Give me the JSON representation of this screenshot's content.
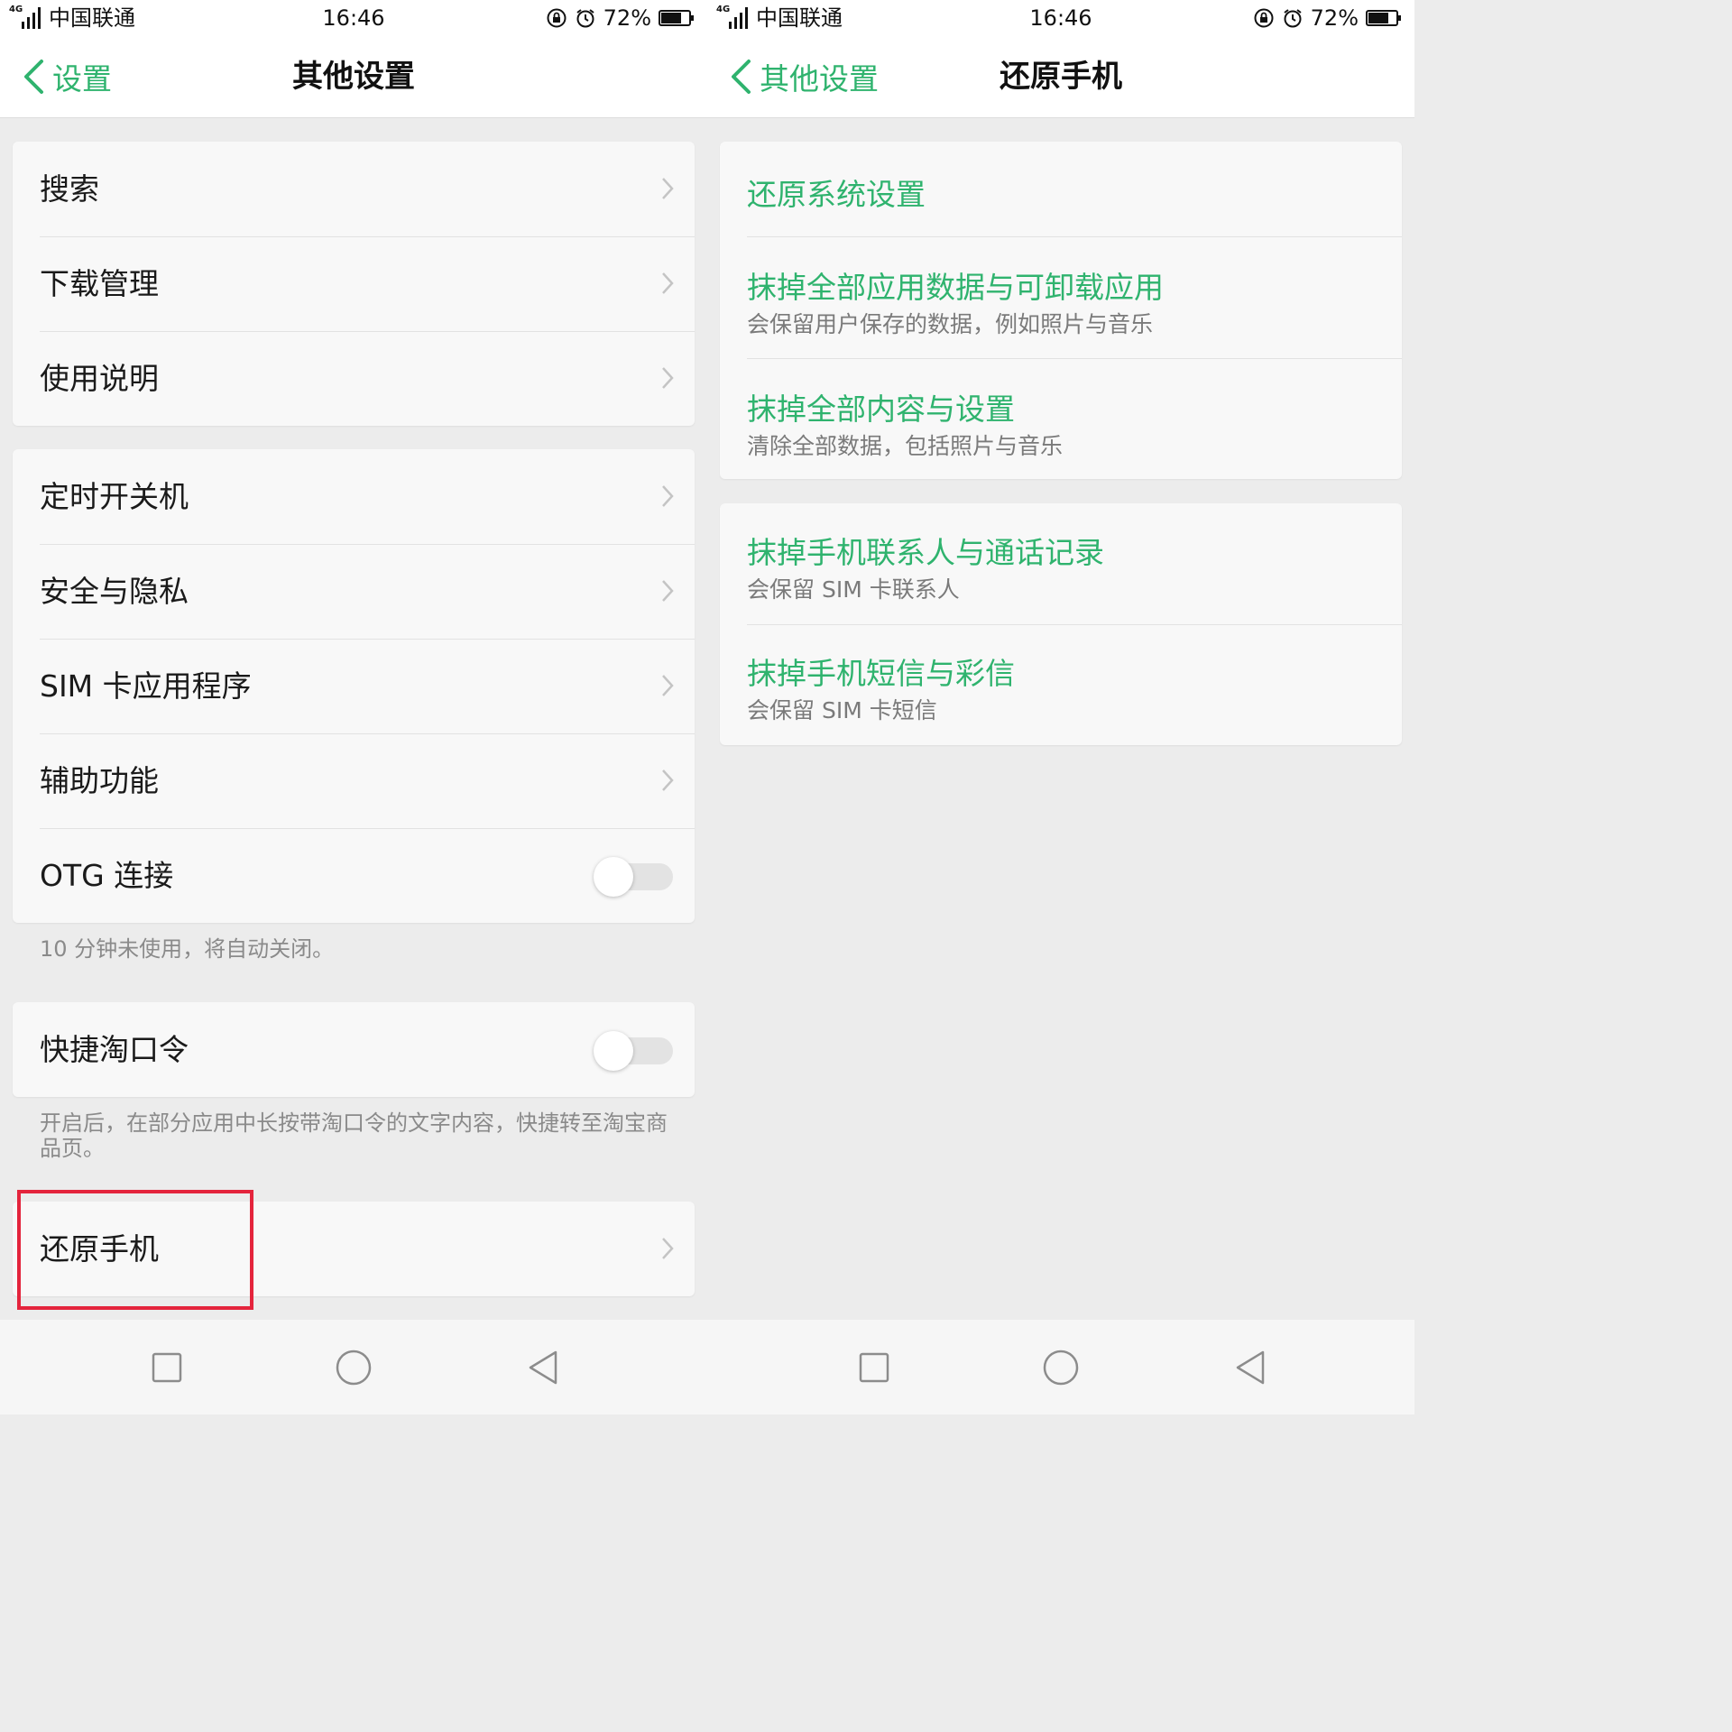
{
  "colors": {
    "accent": "#2fb36e",
    "highlight": "#e4243c"
  },
  "left": {
    "status": {
      "network": "4G",
      "carrier": "中国联通",
      "time": "16:46",
      "battery": "72%",
      "icons": [
        "rotation-lock-icon",
        "alarm-icon",
        "battery-icon"
      ]
    },
    "nav": {
      "back_label": "设置",
      "title": "其他设置"
    },
    "group1": [
      "搜索",
      "下载管理",
      "使用说明"
    ],
    "group2": [
      "定时开关机",
      "安全与隐私",
      "SIM 卡应用程序",
      "辅助功能"
    ],
    "otg": {
      "label": "OTG 连接",
      "on": false,
      "note": "10 分钟未使用，将自动关闭。"
    },
    "taobao": {
      "label": "快捷淘口令",
      "on": false,
      "note": "开启后，在部分应用中长按带淘口令的文字内容，快捷转至淘宝商品页。"
    },
    "reset": {
      "label": "还原手机"
    },
    "sysnav": [
      "square-recents-icon",
      "circle-home-icon",
      "triangle-back-icon"
    ]
  },
  "right": {
    "status": {
      "network": "4G",
      "carrier": "中国联通",
      "time": "16:46",
      "battery": "72%"
    },
    "nav": {
      "back_label": "其他设置",
      "title": "还原手机"
    },
    "group1": [
      {
        "title": "还原系统设置",
        "subtitle": ""
      },
      {
        "title": "抹掉全部应用数据与可卸载应用",
        "subtitle": "会保留用户保存的数据，例如照片与音乐"
      },
      {
        "title": "抹掉全部内容与设置",
        "subtitle": "清除全部数据，包括照片与音乐"
      }
    ],
    "group2": [
      {
        "title": "抹掉手机联系人与通话记录",
        "subtitle": "会保留 SIM 卡联系人"
      },
      {
        "title": "抹掉手机短信与彩信",
        "subtitle": "会保留 SIM 卡短信"
      }
    ]
  }
}
